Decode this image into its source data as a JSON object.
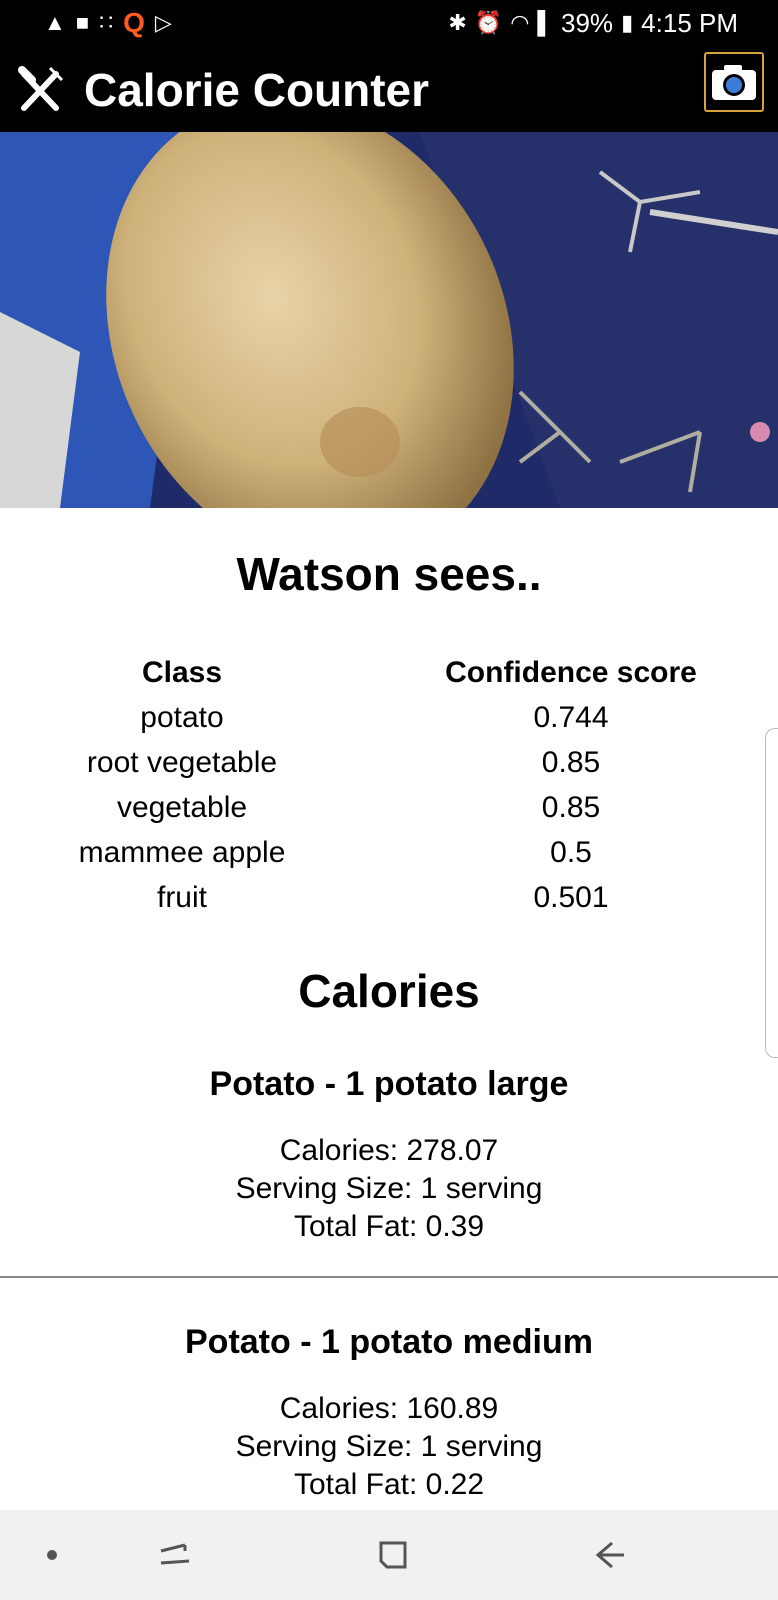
{
  "status_bar": {
    "battery": "39%",
    "time": "4:15 PM",
    "notification_icons": [
      "snapchat-icon",
      "video-icon",
      "apps-icon",
      "q-icon",
      "play-icon"
    ],
    "system_icons": [
      "bluetooth-icon",
      "alarm-icon",
      "wifi-icon",
      "signal-icon",
      "battery-icon"
    ]
  },
  "app_bar": {
    "title": "Calorie Counter",
    "logo_icon": "fork-knife-icon",
    "camera_icon": "camera-icon",
    "accent": "#d8a23a"
  },
  "photo": {
    "subject": "potato"
  },
  "results": {
    "heading": "Watson sees..",
    "columns": [
      "Class",
      "Confidence score"
    ],
    "rows": [
      {
        "class": "potato",
        "score": "0.744"
      },
      {
        "class": "root vegetable",
        "score": "0.85"
      },
      {
        "class": "vegetable",
        "score": "0.85"
      },
      {
        "class": "mammee apple",
        "score": "0.5"
      },
      {
        "class": "fruit",
        "score": "0.501"
      }
    ]
  },
  "calories": {
    "heading": "Calories",
    "items": [
      {
        "title": "Potato - 1 potato large",
        "calories": "Calories: 278.07",
        "serving": "Serving Size: 1 serving",
        "fat": "Total Fat: 0.39"
      },
      {
        "title": "Potato - 1 potato medium",
        "calories": "Calories: 160.89",
        "serving": "Serving Size: 1 serving",
        "fat": "Total Fat: 0.22"
      }
    ]
  },
  "nav_bar": {
    "icons": [
      "dot-icon",
      "recent-apps-icon",
      "home-icon",
      "back-icon"
    ]
  }
}
